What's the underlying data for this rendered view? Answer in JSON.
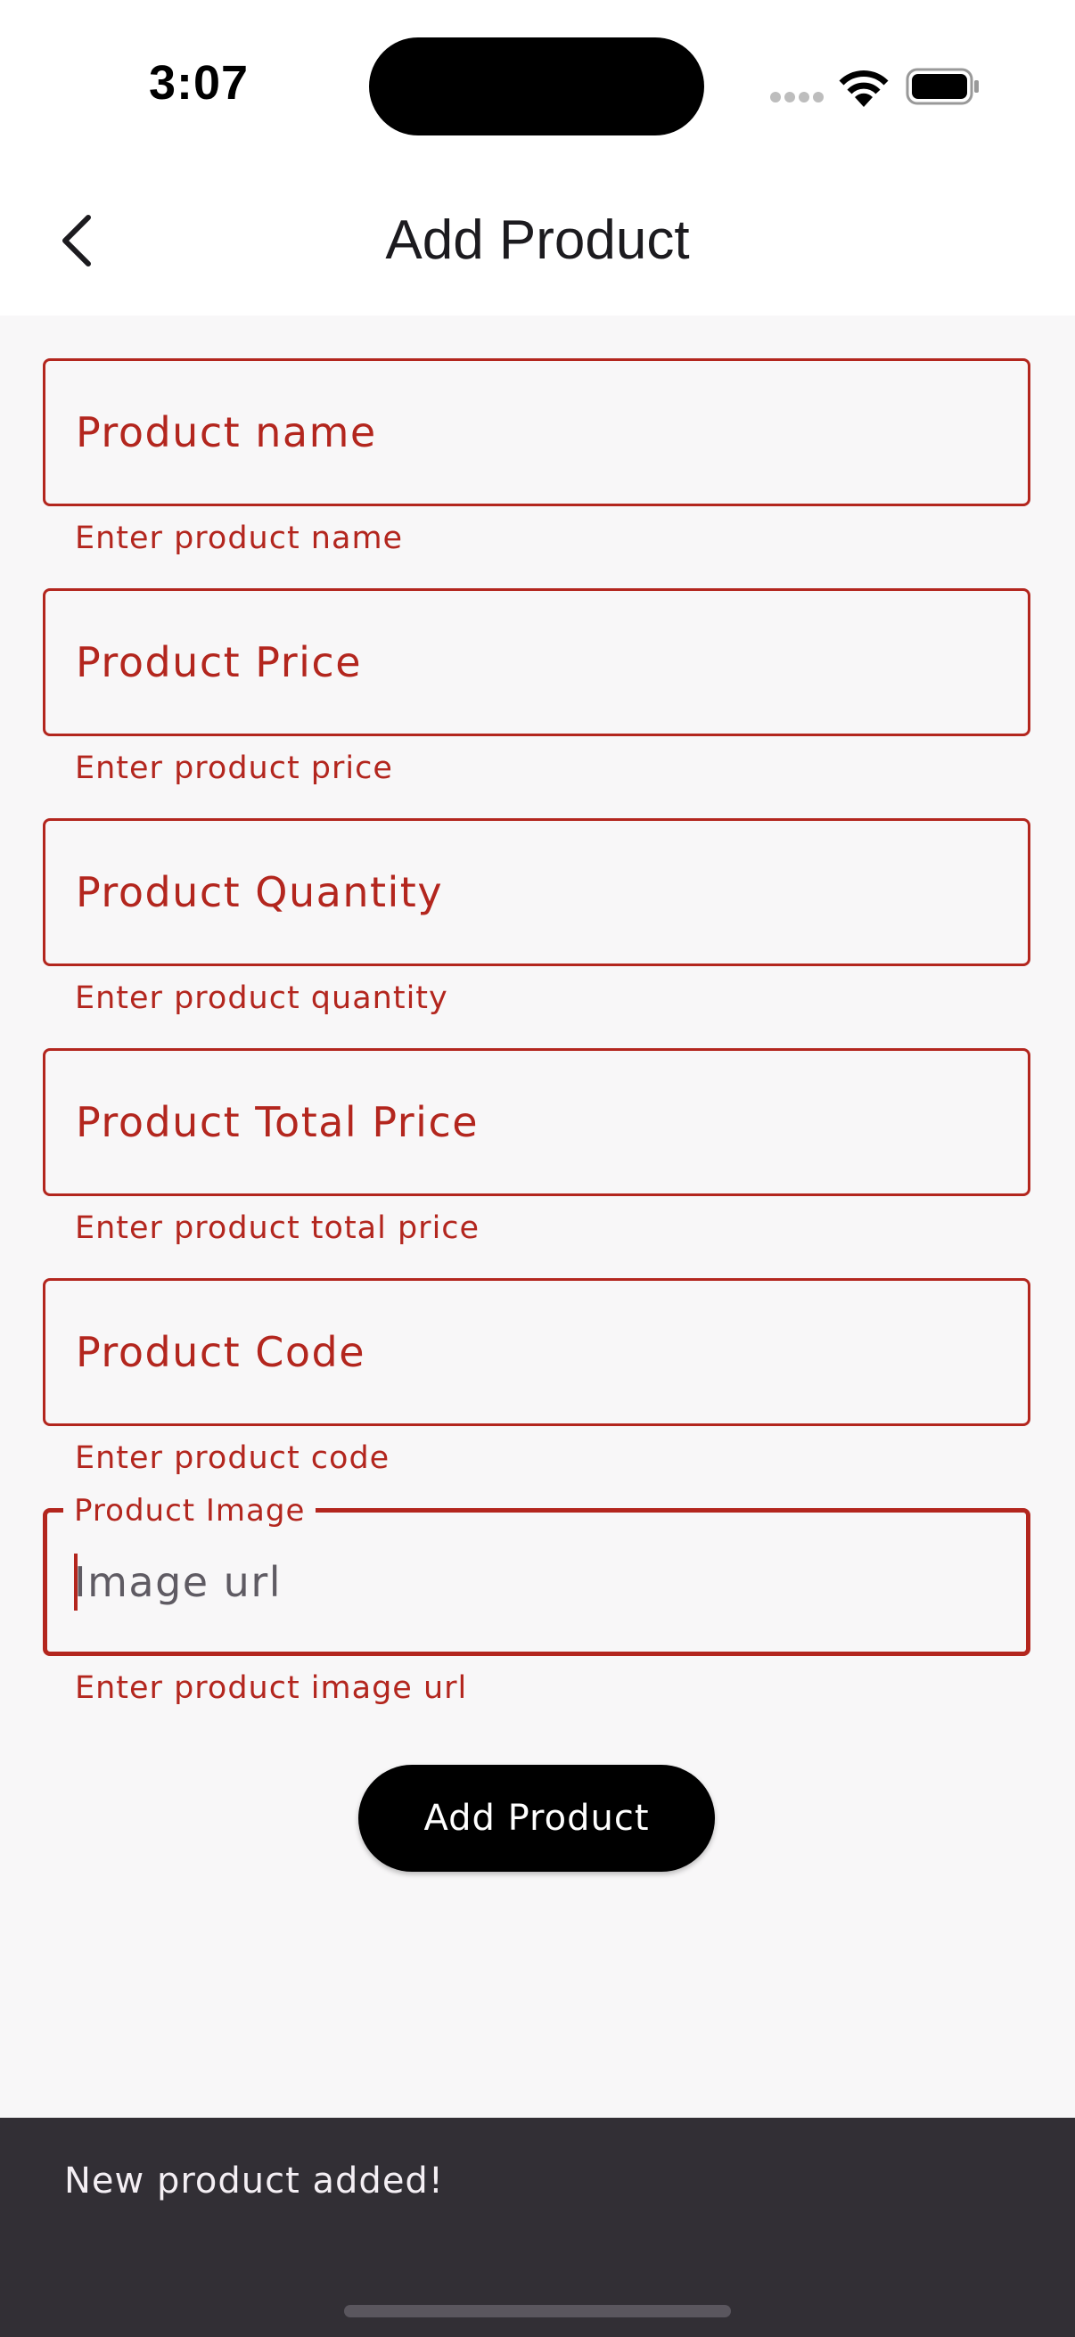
{
  "status_bar": {
    "time": "3:07",
    "icons": [
      "signal-icon",
      "wifi-icon",
      "battery-icon"
    ]
  },
  "app_bar": {
    "title": "Add Product",
    "back_icon": "chevron-left-icon"
  },
  "form": {
    "fields": [
      {
        "label": "Product name",
        "helper": "Enter product name"
      },
      {
        "label": "Product Price",
        "helper": "Enter product price"
      },
      {
        "label": "Product Quantity",
        "helper": "Enter product quantity"
      },
      {
        "label": "Product Total Price",
        "helper": "Enter product total price"
      },
      {
        "label": "Product Code",
        "helper": "Enter product code"
      }
    ],
    "image_field": {
      "label": "Product Image",
      "placeholder": "Image url",
      "helper": "Enter product image url"
    },
    "submit_label": "Add Product"
  },
  "snackbar": {
    "message": "New product added!"
  },
  "colors": {
    "error": "#b3261e",
    "background": "#f8f7f8",
    "button": "#000000",
    "snackbar": "#322f35"
  }
}
